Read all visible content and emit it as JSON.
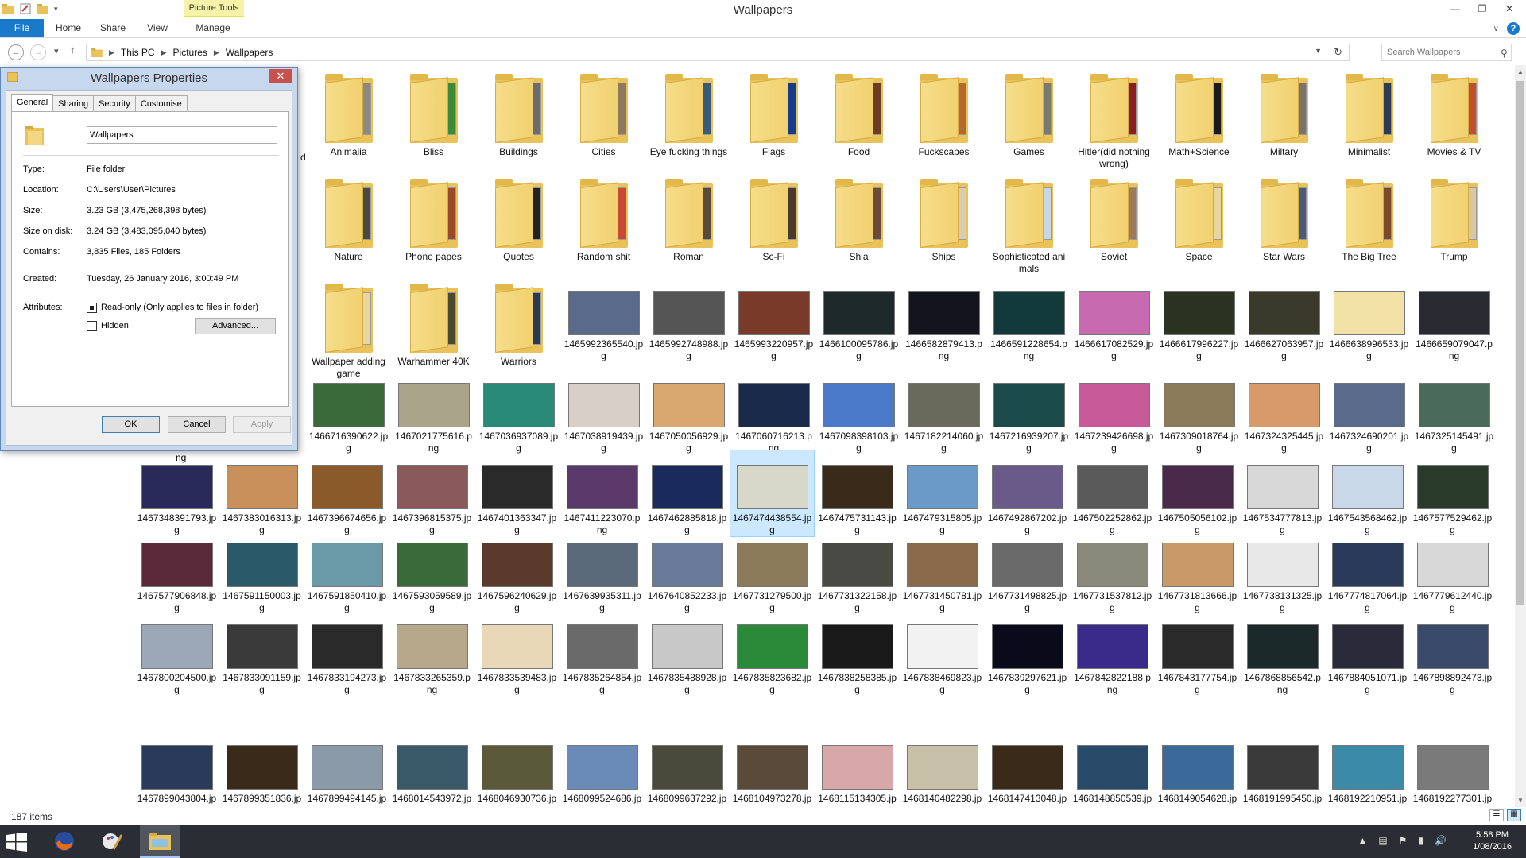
{
  "window": {
    "title": "Wallpapers",
    "contextual_tab": "Picture Tools"
  },
  "ribbon": {
    "tabs": [
      "File",
      "Home",
      "Share",
      "View",
      "Manage"
    ]
  },
  "address": {
    "crumbs": [
      "This PC",
      "Pictures",
      "Wallpapers"
    ],
    "search_placeholder": "Search Wallpapers"
  },
  "colors": {
    "accent": "#1979ca",
    "selection": "#cce8ff",
    "dialog_frame": "#c6d7ee",
    "taskbar": "#2a2d33",
    "close_red": "#c7514b"
  },
  "folders": [
    {
      "name": "Animalia",
      "doc": "#8a8a80"
    },
    {
      "name": "Bliss",
      "doc": "#3b8a3a"
    },
    {
      "name": "Buildings",
      "doc": "#6c6c6c"
    },
    {
      "name": "Cities",
      "doc": "#8d7a5e"
    },
    {
      "name": "Eye fucking things",
      "doc": "#3a5a7a"
    },
    {
      "name": "Flags",
      "doc": "#173a8c"
    },
    {
      "name": "Food",
      "doc": "#6b3b22"
    },
    {
      "name": "Fuckscapes",
      "doc": "#b46a2c"
    },
    {
      "name": "Games",
      "doc": "#7a7a70"
    },
    {
      "name": "Hitler(did nothing wrong)",
      "doc": "#8a1e1e"
    },
    {
      "name": "Math+Science",
      "doc": "#1a1a1a"
    },
    {
      "name": "Miltary",
      "doc": "#7c7366"
    },
    {
      "name": "Minimalist",
      "doc": "#2f3a55"
    },
    {
      "name": "Movies & TV",
      "doc": "#c0502a"
    },
    {
      "name": "Nature",
      "doc": "#4a4a44"
    },
    {
      "name": "Phone papes",
      "doc": "#9a4a2a"
    },
    {
      "name": "Quotes",
      "doc": "#222222"
    },
    {
      "name": "Random shit",
      "doc": "#c84a32"
    },
    {
      "name": "Roman",
      "doc": "#5b4a3a"
    },
    {
      "name": "Sc-Fi",
      "doc": "#4a3a2e"
    },
    {
      "name": "Shia",
      "doc": "#6b4a3a"
    },
    {
      "name": "Ships",
      "doc": "#d9cdb0"
    },
    {
      "name": "Sophisticated animals",
      "doc": "#c8d8e2"
    },
    {
      "name": "Soviet",
      "doc": "#a0785a"
    },
    {
      "name": "Space",
      "doc": "#e8d6a0"
    },
    {
      "name": "Star Wars",
      "doc": "#4a5a7a"
    },
    {
      "name": "The Big Tree",
      "doc": "#7a4a2a"
    },
    {
      "name": "Trump",
      "doc": "#d7c8a2"
    },
    {
      "name": "Wallpaper adding game",
      "doc": "#e8d6a0"
    },
    {
      "name": "Warhammer 40K",
      "doc": "#4a4a30"
    },
    {
      "name": "Warriors",
      "doc": "#2a3a50"
    }
  ],
  "images": [
    {
      "name": "1465992365540.jpg",
      "color": "#5a6a8a"
    },
    {
      "name": "1465992748988.jpg",
      "color": "#555555"
    },
    {
      "name": "1465993220957.jpg",
      "color": "#7a3a2a"
    },
    {
      "name": "1466100095786.jpg",
      "color": "#1e2a2a"
    },
    {
      "name": "1466582879413.png",
      "color": "#14141e"
    },
    {
      "name": "1466591228654.png",
      "color": "#123a3a"
    },
    {
      "name": "1466617082529.jpg",
      "color": "#c86ab0"
    },
    {
      "name": "1466617996227.jpg",
      "color": "#2a3320"
    },
    {
      "name": "1466627063957.jpg",
      "color": "#3a3a2a"
    },
    {
      "name": "1466638996533.jpg",
      "color": "#f2e2a8"
    },
    {
      "name": "1466659079047.png",
      "color": "#2a2a32"
    },
    {
      "name": "1466716390622.jpg",
      "color": "#3a6a3a"
    },
    {
      "name": "1467021775616.png",
      "color": "#aaa48a"
    },
    {
      "name": "1467036937089.jpg",
      "color": "#2a8a7a"
    },
    {
      "name": "1467038919439.jpg",
      "color": "#d8d0c8"
    },
    {
      "name": "1467050056929.jpg",
      "color": "#d8a870"
    },
    {
      "name": "1467060716213.png",
      "color": "#1a2a4a"
    },
    {
      "name": "1467098398103.jpg",
      "color": "#4a7ac8"
    },
    {
      "name": "1467182214060.jpg",
      "color": "#6a6a5a"
    },
    {
      "name": "1467216939207.jpg",
      "color": "#1a4a4a"
    },
    {
      "name": "1467239426698.jpg",
      "color": "#c85a9a"
    },
    {
      "name": "1467309018764.jpg",
      "color": "#8a7a5a"
    },
    {
      "name": "1467324325445.jpg",
      "color": "#d89a6a"
    },
    {
      "name": "1467324690201.jpg",
      "color": "#5a6a8a"
    },
    {
      "name": "1467325145491.jpg",
      "color": "#4a6a5a"
    },
    {
      "name": "1467348391793.jpg",
      "color": "#2a2a5a"
    },
    {
      "name": "1467383016313.jpg",
      "color": "#c8905a"
    },
    {
      "name": "1467396674656.jpg",
      "color": "#8a5a2a"
    },
    {
      "name": "1467396815375.jpg",
      "color": "#8a5a5a"
    },
    {
      "name": "1467401363347.jpg",
      "color": "#2a2a2a"
    },
    {
      "name": "1467411223070.png",
      "color": "#5a3a6a"
    },
    {
      "name": "1467462885818.jpg",
      "color": "#1a2a5a"
    },
    {
      "name": "1467474438554.jpg",
      "color": "#d8d8c8"
    },
    {
      "name": "1467475731143.jpg",
      "color": "#3a2a1a"
    },
    {
      "name": "1467479315805.jpg",
      "color": "#6a9ac8"
    },
    {
      "name": "1467492867202.jpg",
      "color": "#6a5a8a"
    },
    {
      "name": "1467502252862.jpg",
      "color": "#5a5a5a"
    },
    {
      "name": "1467505056102.jpg",
      "color": "#4a2a4a"
    },
    {
      "name": "1467534777813.jpg",
      "color": "#d8d8d8"
    },
    {
      "name": "1467543568462.jpg",
      "color": "#c8d8e8"
    },
    {
      "name": "1467577529462.jpg",
      "color": "#2a3a2a"
    },
    {
      "name": "1467577906848.jpg",
      "color": "#5a2a3a"
    },
    {
      "name": "1467591150003.jpg",
      "color": "#2a5a6a"
    },
    {
      "name": "1467591850410.jpg",
      "color": "#6a9aa8"
    },
    {
      "name": "1467593059589.jpg",
      "color": "#3a6a3a"
    },
    {
      "name": "1467596240629.jpg",
      "color": "#5a3a2a"
    },
    {
      "name": "1467639935311.jpg",
      "color": "#5a6a7a"
    },
    {
      "name": "1467640852233.jpg",
      "color": "#6a7a9a"
    },
    {
      "name": "1467731279500.jpg",
      "color": "#8a7a5a"
    },
    {
      "name": "1467731322158.jpg",
      "color": "#4a4a44"
    },
    {
      "name": "1467731450781.jpg",
      "color": "#8a6a4a"
    },
    {
      "name": "1467731498825.jpg",
      "color": "#6a6a6a"
    },
    {
      "name": "1467731537812.jpg",
      "color": "#8a8a7a"
    },
    {
      "name": "1467731813666.jpg",
      "color": "#c89a6a"
    },
    {
      "name": "1467738131325.jpg",
      "color": "#e8e8e8"
    },
    {
      "name": "1467774817064.jpg",
      "color": "#2a3a5a"
    },
    {
      "name": "1467779612440.jpg",
      "color": "#d8d8d8"
    },
    {
      "name": "1467800204500.jpg",
      "color": "#9aa8b8"
    },
    {
      "name": "1467833091159.jpg",
      "color": "#3a3a3a"
    },
    {
      "name": "1467833194273.jpg",
      "color": "#2a2a2a"
    },
    {
      "name": "1467833265359.png",
      "color": "#b8a88a"
    },
    {
      "name": "1467833539483.jpg",
      "color": "#e8d8b8"
    },
    {
      "name": "1467835264854.jpg",
      "color": "#6a6a6a"
    },
    {
      "name": "1467835488928.jpg",
      "color": "#c8c8c8"
    },
    {
      "name": "1467835823682.jpg",
      "color": "#2a8a3a"
    },
    {
      "name": "1467838258385.jpg",
      "color": "#1a1a1a"
    },
    {
      "name": "1467838469823.jpg",
      "color": "#f2f2f2"
    },
    {
      "name": "1467839297621.jpg",
      "color": "#0a0a1a"
    },
    {
      "name": "1467842822188.png",
      "color": "#3a2a8a"
    },
    {
      "name": "1467843177754.jpg",
      "color": "#2a2a2a"
    },
    {
      "name": "1467868856542.png",
      "color": "#1a2a2a"
    },
    {
      "name": "1467884051071.jpg",
      "color": "#2a2a3a"
    },
    {
      "name": "1467898892473.jpg",
      "color": "#3a4a6a"
    },
    {
      "name": "1467899043804.jpg",
      "color": "#2a3a5a"
    },
    {
      "name": "1467899351836.jpg",
      "color": "#3a2a1a"
    },
    {
      "name": "1467899494145.jpg",
      "color": "#8a9aa8"
    },
    {
      "name": "1468014543972.jpg",
      "color": "#3a5a6a"
    },
    {
      "name": "1468046930736.jpg",
      "color": "#5a5a3a"
    },
    {
      "name": "1468099524686.jpg",
      "color": "#6a8ab8"
    },
    {
      "name": "1468099637292.jpg",
      "color": "#4a4a3a"
    },
    {
      "name": "1468104973278.jpg",
      "color": "#5a4a3a"
    },
    {
      "name": "1468115134305.jpg",
      "color": "#d8a8a8"
    },
    {
      "name": "1468140482298.jpg",
      "color": "#c8c0a8"
    },
    {
      "name": "1468147413048.jpg",
      "color": "#3a2a1a"
    },
    {
      "name": "1468148850539.jpg",
      "color": "#2a4a6a"
    },
    {
      "name": "1468149054628.jpg",
      "color": "#3a6a9a"
    },
    {
      "name": "1468191995450.jpg",
      "color": "#3a3a3a"
    },
    {
      "name": "1468192210951.jpg",
      "color": "#3a8aa8"
    },
    {
      "name": "1468192277301.jpg",
      "color": "#7a7a7a"
    }
  ],
  "selected_image": "1467474438554.jpg",
  "dialog": {
    "title": "Wallpapers Properties",
    "tabs": [
      "General",
      "Sharing",
      "Security",
      "Customise"
    ],
    "name_value": "Wallpapers",
    "rows": [
      {
        "label": "Type:",
        "value": "File folder"
      },
      {
        "label": "Location:",
        "value": "C:\\Users\\User\\Pictures"
      },
      {
        "label": "Size:",
        "value": "3.23 GB (3,475,268,398 bytes)"
      },
      {
        "label": "Size on disk:",
        "value": "3.24 GB (3,483,095,040 bytes)"
      },
      {
        "label": "Contains:",
        "value": "3,835 Files, 185 Folders"
      },
      {
        "label": "Created:",
        "value": "Tuesday, 26 January 2016, 3:00:49 PM"
      }
    ],
    "attributes_label": "Attributes:",
    "readonly_label": "Read-only (Only applies to files in folder)",
    "readonly_checked": true,
    "hidden_label": "Hidden",
    "hidden_checked": false,
    "advanced_button": "Advanced...",
    "ok_button": "OK",
    "cancel_button": "Cancel",
    "apply_button": "Apply",
    "clipped_right_text": [
      "d",
      "ng"
    ]
  },
  "status": {
    "count": "187 items"
  },
  "taskbar": {
    "time": "5:58 PM",
    "date": "1/08/2016"
  }
}
